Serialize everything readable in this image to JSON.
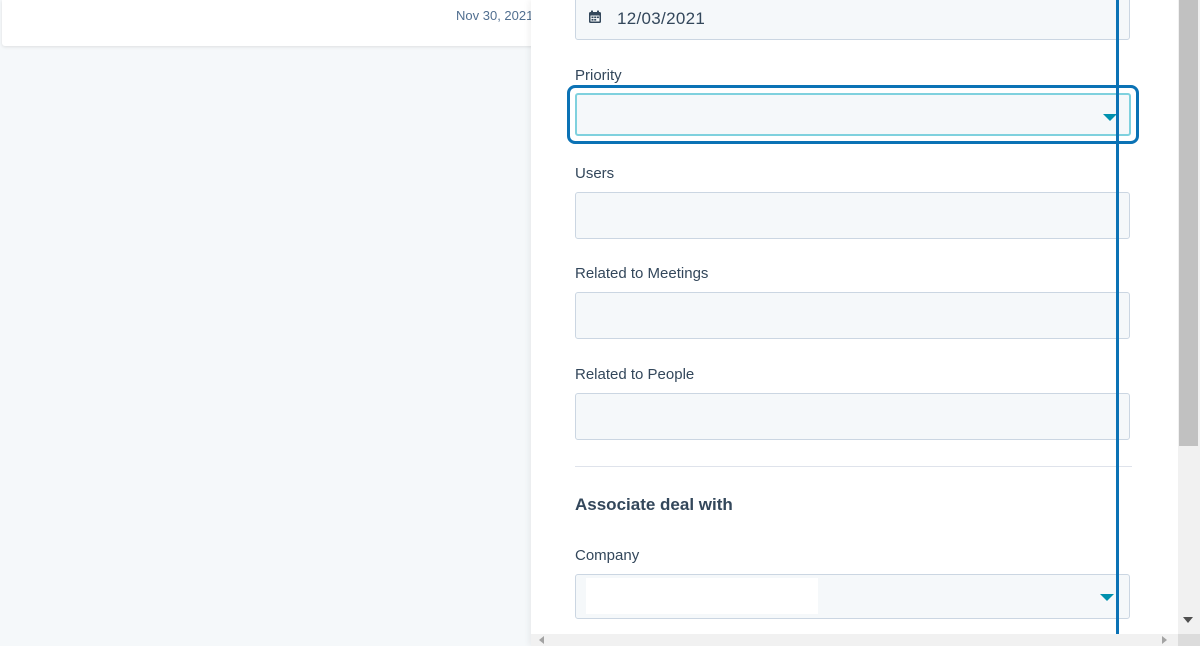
{
  "background": {
    "date_text": "Nov 30, 2021"
  },
  "form": {
    "due_date": {
      "value": "12/03/2021",
      "icon": "calendar-icon"
    },
    "priority": {
      "label": "Priority",
      "value": ""
    },
    "users": {
      "label": "Users",
      "value": ""
    },
    "related_meetings": {
      "label": "Related to Meetings",
      "value": ""
    },
    "related_people": {
      "label": "Related to People",
      "value": ""
    },
    "associate_section": {
      "title": "Associate deal with"
    },
    "company": {
      "label": "Company",
      "value": ""
    }
  },
  "colors": {
    "focus_ring": "#0b72b5",
    "caret": "#0091ae",
    "text": "#33475b",
    "field_bg": "#f5f8fa",
    "field_border": "#cbd6e2"
  }
}
